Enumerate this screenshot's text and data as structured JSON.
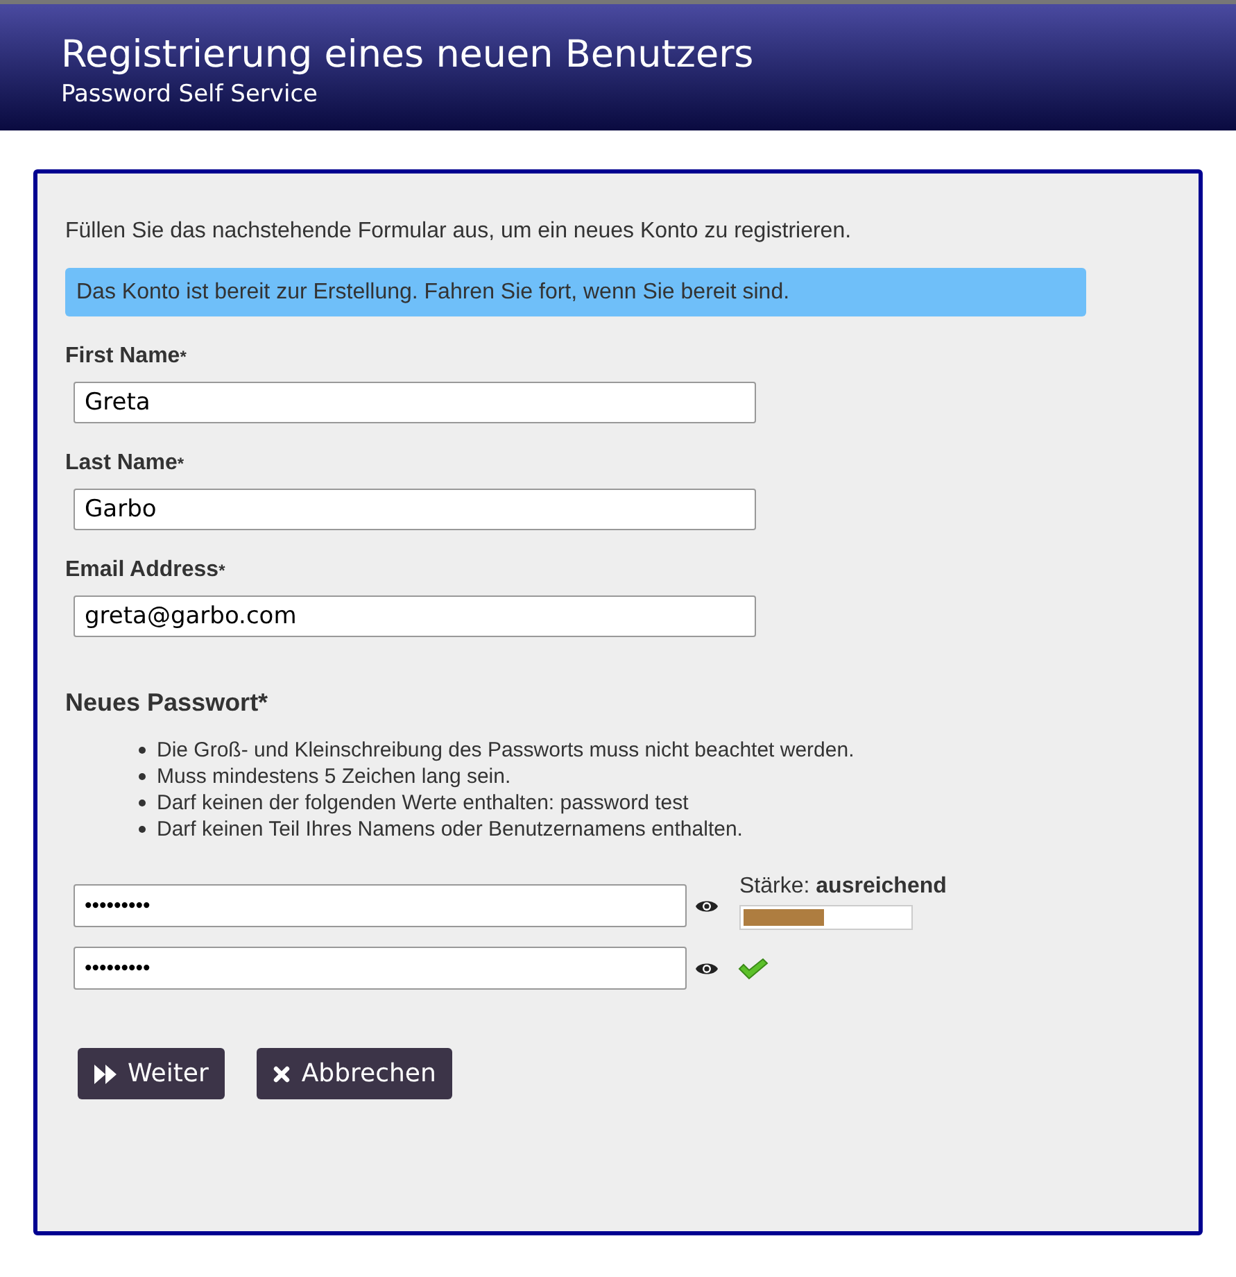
{
  "header": {
    "title": "Registrierung eines neuen Benutzers",
    "subtitle": "Password Self Service"
  },
  "intro": "Füllen Sie das nachstehende Formular aus, um ein neues Konto zu registrieren.",
  "notice": "Das Konto ist bereit zur Erstellung. Fahren Sie fort, wenn Sie bereit sind.",
  "fields": [
    {
      "label": "First Name",
      "required_mark": "*",
      "value": "Greta"
    },
    {
      "label": "Last Name",
      "required_mark": "*",
      "value": "Garbo"
    },
    {
      "label": "Email Address",
      "required_mark": "*",
      "value": "greta@garbo.com"
    }
  ],
  "password": {
    "heading": "Neues Passwort*",
    "rules": [
      "Die Groß- und Kleinschreibung des Passworts muss nicht beachtet werden.",
      "Muss mindestens 5 Zeichen lang sein.",
      "Darf keinen der folgenden Werte enthalten: password test",
      "Darf keinen Teil Ihres Namens oder Benutzernamens enthalten."
    ],
    "value": "•••••••••",
    "strength_label": "Stärke: **ausreichend**",
    "level": 0.49,
    "confirm_value": "•••••••••",
    "match": true
  },
  "buttons": [
    {
      "kind": "next",
      "label": "Weiter"
    },
    {
      "kind": "cancel",
      "label": "Abbrechen"
    }
  ]
}
